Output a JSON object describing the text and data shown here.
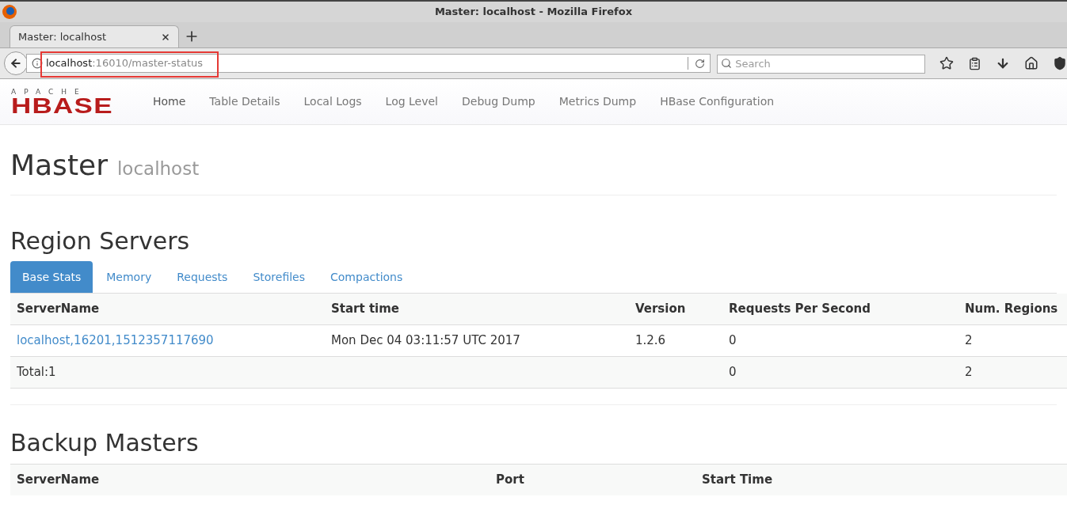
{
  "window": {
    "title": "Master: localhost - Mozilla Firefox"
  },
  "browser_tabs": [
    {
      "label": "Master: localhost",
      "selected": true
    }
  ],
  "address_bar": {
    "host": "localhost",
    "path": ":16010/master-status"
  },
  "search": {
    "placeholder": "Search"
  },
  "nav": {
    "logo_top": "APACHE",
    "logo_main": "HBASE",
    "items": [
      {
        "label": "Home",
        "selected": true
      },
      {
        "label": "Table Details",
        "selected": false
      },
      {
        "label": "Local Logs",
        "selected": false
      },
      {
        "label": "Log Level",
        "selected": false
      },
      {
        "label": "Debug Dump",
        "selected": false
      },
      {
        "label": "Metrics Dump",
        "selected": false
      },
      {
        "label": "HBase Configuration",
        "selected": false
      }
    ]
  },
  "header": {
    "title": "Master",
    "subtitle": "localhost"
  },
  "region_servers": {
    "title": "Region Servers",
    "tabs": [
      {
        "label": "Base Stats",
        "selected": true
      },
      {
        "label": "Memory",
        "selected": false
      },
      {
        "label": "Requests",
        "selected": false
      },
      {
        "label": "Storefiles",
        "selected": false
      },
      {
        "label": "Compactions",
        "selected": false
      }
    ],
    "columns": [
      "ServerName",
      "Start time",
      "Version",
      "Requests Per Second",
      "Num. Regions"
    ],
    "rows": [
      {
        "kind": "server",
        "cells": [
          "localhost,16201,1512357117690",
          "Mon Dec 04 03:11:57 UTC 2017",
          "1.2.6",
          "0",
          "2"
        ]
      },
      {
        "kind": "total",
        "cells": [
          "Total:1",
          "",
          "",
          "0",
          "2"
        ]
      }
    ]
  },
  "backup_masters": {
    "title": "Backup Masters",
    "columns": [
      "ServerName",
      "Port",
      "Start Time"
    ]
  }
}
